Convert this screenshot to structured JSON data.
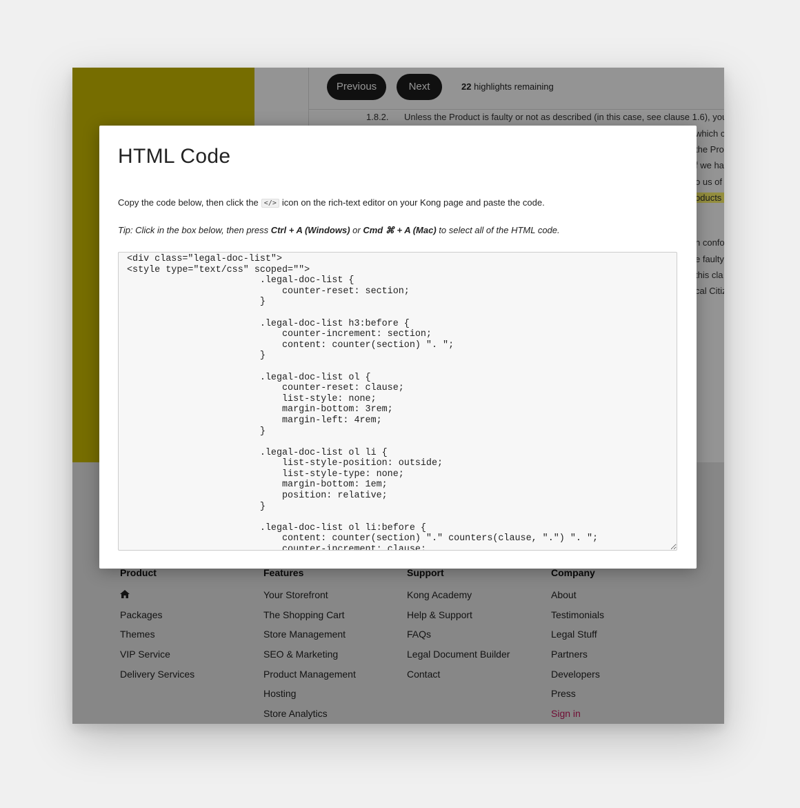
{
  "doc": {
    "prev_label": "Previous",
    "next_label": "Next",
    "highlights_count": "22",
    "highlights_text": "highlights remaining",
    "clause_number": "1.8.2.",
    "clause_text": "Unless the Product is faulty or not as described (in this case, see clause 1.6), you v",
    "fragments": [
      "which c",
      "the Pro",
      "f we ha",
      "o us of",
      "oducts",
      "n confo",
      "e faulty",
      "this cla",
      "cal Citiz"
    ]
  },
  "footer": {
    "columns": [
      {
        "heading": "Product",
        "links": [
          "home-icon",
          "Packages",
          "Themes",
          "VIP Service",
          "Delivery Services"
        ]
      },
      {
        "heading": "Features",
        "links": [
          "Your Storefront",
          "The Shopping Cart",
          "Store Management",
          "SEO & Marketing",
          "Product Management",
          "Hosting",
          "Store Analytics"
        ]
      },
      {
        "heading": "Support",
        "links": [
          "Kong Academy",
          "Help & Support",
          "FAQs",
          "Legal Document Builder",
          "Contact"
        ]
      },
      {
        "heading": "Company",
        "links": [
          "About",
          "Testimonials",
          "Legal Stuff",
          "Partners",
          "Developers",
          "Press",
          "Sign in"
        ]
      }
    ]
  },
  "modal": {
    "title": "HTML Code",
    "instruction_before": "Copy the code below, then click the",
    "instruction_icon": "</>",
    "instruction_after": "icon on the rich-text editor on your Kong page and paste the code.",
    "tip_prefix": "Tip: Click in the box below, then press ",
    "tip_windows_keys": "Ctrl + A (Windows)",
    "tip_or": " or ",
    "tip_mac_keys": "Cmd ⌘ + A (Mac)",
    "tip_suffix": " to select all of the HTML code.",
    "code": "<div class=\"legal-doc-list\">\n<style type=\"text/css\" scoped=\"\">\n                        .legal-doc-list {\n                            counter-reset: section;\n                        }\n\n                        .legal-doc-list h3:before {\n                            counter-increment: section;\n                            content: counter(section) \". \";\n                        }\n\n                        .legal-doc-list ol {\n                            counter-reset: clause;\n                            list-style: none;\n                            margin-bottom: 3rem;\n                            margin-left: 4rem;\n                        }\n\n                        .legal-doc-list ol li {\n                            list-style-position: outside;\n                            list-style-type: none;\n                            margin-bottom: 1em;\n                            position: relative;\n                        }\n\n                        .legal-doc-list ol li:before {\n                            content: counter(section) \".\" counters(clause, \".\") \". \";\n                            counter-increment: clause;"
  }
}
